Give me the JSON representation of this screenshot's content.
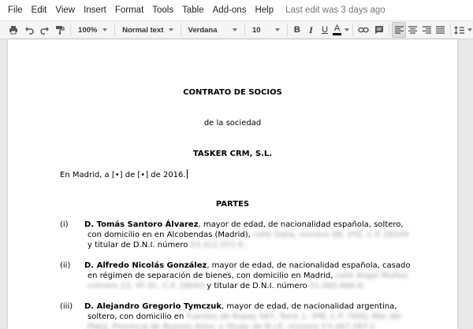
{
  "menu": {
    "items": [
      "File",
      "Edit",
      "View",
      "Insert",
      "Format",
      "Tools",
      "Table",
      "Add-ons",
      "Help"
    ],
    "last_edit": "Last edit was 3 days ago"
  },
  "toolbar": {
    "zoom": "100%",
    "style": "Normal text",
    "font": "Verdana",
    "size": "10",
    "bold": "B",
    "italic": "I",
    "underline": "U",
    "text_color": "A"
  },
  "document": {
    "title": "CONTRATO DE SOCIOS",
    "subtitle": "de la sociedad",
    "company": "TASKER CRM, S.L.",
    "place_date": "En Madrid, a [•] de [•] de 2016.",
    "section": "PARTES",
    "parties": [
      {
        "num": "(i)",
        "name": "D. Tomás Santoro Álvarez",
        "line1": ", mayor de edad, de nacionalidad española, soltero,",
        "line2": "con domicilio en en Alcobendas (Madrid),",
        "line2_blur": "calle Dalia, número 68, 2ºD, C.P. 28109",
        "line3": "y titular de D.N.I. número",
        "line3_blur": "53.412.071-E;"
      },
      {
        "num": "(ii)",
        "name": "D. Alfredo Nicolás González",
        "line1": ", mayor de edad, de nacionalidad española, casado",
        "line2": "en régimen de separación de bienes, con domicilio en Madrid,",
        "line2_blur": "calle Ángel Muñoz,",
        "line3_blur_a": "número 22, 4º-3C, C.P. 28043",
        "line3": "y titular de D.N.I. número",
        "line3_blur_b": "51.065.666-K;"
      },
      {
        "num": "(iii)",
        "name": "D. Alejandro Gregorio Tymczuk",
        "line1": ", mayor de edad, de nacionalidad argentina,",
        "line2": "soltero, con domicilio en",
        "line2_blur": "Fuentes de Ropay 567, Torre 1, 3ºB, C.P. 7600, Mar del",
        "line3_blur": "Plata, Provincia de Buenos Aires, y titular de N.I.E. número Y-5.467.267-C"
      }
    ]
  }
}
